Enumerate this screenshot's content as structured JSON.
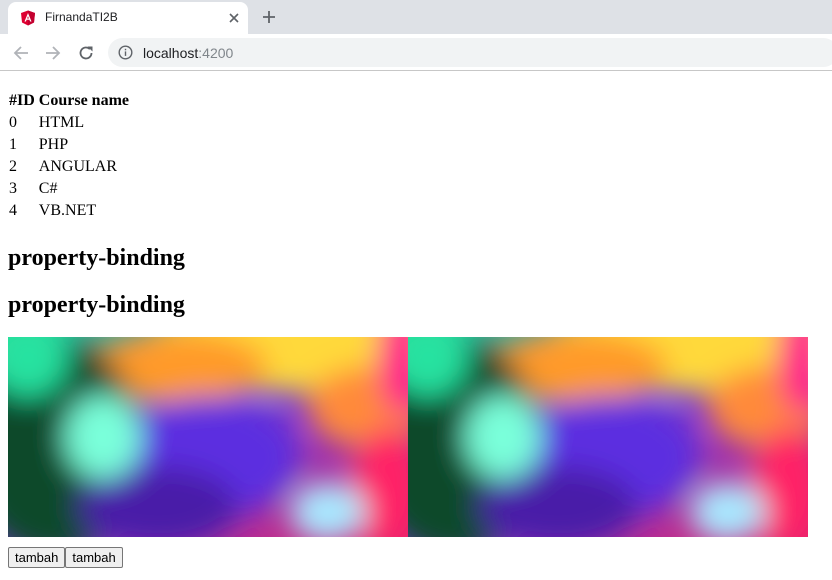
{
  "browser": {
    "tab_title": "FirnandaTI2B",
    "url_host": "localhost",
    "url_port": ":4200",
    "favicon": "angular-icon"
  },
  "courses": {
    "headers": [
      "#ID",
      "Course name"
    ],
    "rows": [
      {
        "id": "0",
        "name": "HTML"
      },
      {
        "id": "1",
        "name": "PHP"
      },
      {
        "id": "2",
        "name": "ANGULAR"
      },
      {
        "id": "3",
        "name": "C#"
      },
      {
        "id": "4",
        "name": "VB.NET"
      }
    ]
  },
  "headings": [
    "property-binding",
    "property-binding"
  ],
  "buttons": [
    "tambah",
    "tambah"
  ],
  "colors": {
    "angular_red": "#dd0031",
    "tab_bg": "#dee1e6",
    "omnibox_bg": "#f1f3f4"
  }
}
